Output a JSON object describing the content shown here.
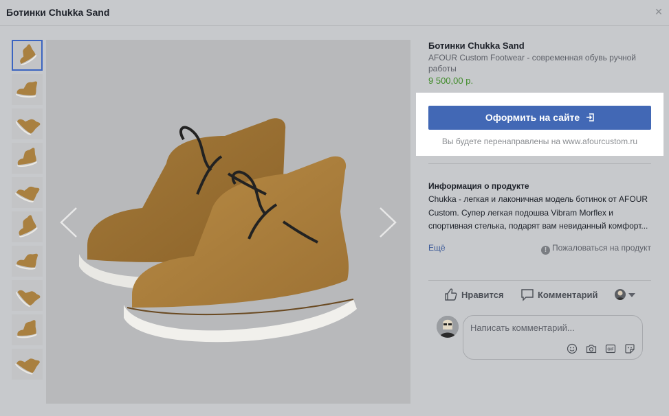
{
  "window": {
    "title": "Ботинки Chukka Sand",
    "close_icon": "close-icon"
  },
  "gallery": {
    "thumbnail_count": 10,
    "active_index": 0,
    "prev_icon": "chevron-left-icon",
    "next_icon": "chevron-right-icon"
  },
  "product": {
    "title": "Ботинки Chukka Sand",
    "subtitle": "AFOUR Custom Footwear - современная обувь ручной работы",
    "price": "9 500,00 р."
  },
  "checkout": {
    "button_label": "Оформить на сайте",
    "button_icon": "external-link-icon",
    "redirect_note": "Вы будете перенаправлены на www.afourcustom.ru"
  },
  "info": {
    "title": "Информация о продукте",
    "description": "Chukka - легкая и лаконичная модель ботинок от AFOUR Custom. Супер легкая подошва Vibram Morflex и спортивная стелька, подарят вам невиданный комфорт...",
    "more_label": "Ещё",
    "report_label": "Пожаловаться на продукт"
  },
  "actions": {
    "like_label": "Нравится",
    "comment_label": "Комментарий"
  },
  "comment_box": {
    "placeholder": "Написать комментарий...",
    "icons": [
      "emoji-icon",
      "camera-icon",
      "gif-icon",
      "sticker-icon"
    ]
  },
  "colors": {
    "accent": "#4268b5",
    "price": "#3f8a28",
    "link": "#3b5998"
  }
}
